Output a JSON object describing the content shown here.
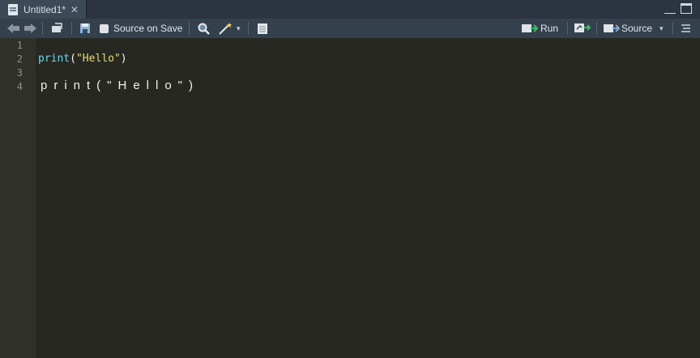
{
  "tab": {
    "title": "Untitled1*",
    "close_glyph": "✕"
  },
  "toolbar": {
    "source_on_save": "Source on Save",
    "run_label": "Run",
    "source_label": "Source",
    "dropdown_glyph": "▾"
  },
  "editor": {
    "line_numbers": [
      "1",
      "2",
      "3",
      "4"
    ],
    "line2": {
      "fn": "print",
      "open": "(",
      "str": "\"Hello\"",
      "close": ")"
    },
    "line4_text": "print(\"Hello\")"
  },
  "colors": {
    "background": "#272822",
    "function": "#66d9ef",
    "string": "#e6db74"
  },
  "icons": [
    "document-icon",
    "close-icon",
    "back-arrow-icon",
    "forward-arrow-icon",
    "show-in-window-icon",
    "save-icon",
    "checkbox-icon",
    "search-icon",
    "magic-wand-icon",
    "compile-report-icon",
    "run-icon",
    "re-run-icon",
    "source-icon",
    "outline-icon",
    "minimize-icon",
    "maximize-icon"
  ]
}
